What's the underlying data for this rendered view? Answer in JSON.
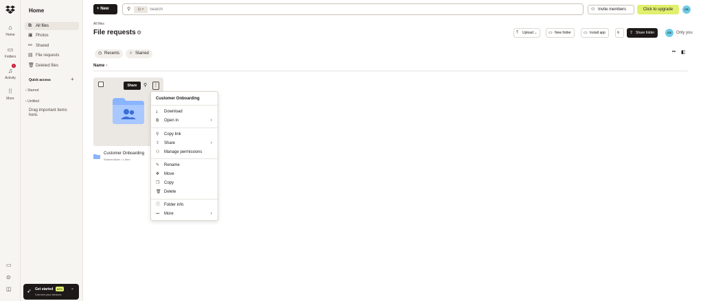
{
  "rail": {
    "items": [
      {
        "label": "Home",
        "icon": "home-icon",
        "glyph": "⌂"
      },
      {
        "label": "Folders",
        "icon": "folders-icon",
        "glyph": "▭"
      },
      {
        "label": "Activity",
        "icon": "bell-icon",
        "glyph": "♫"
      },
      {
        "label": "More",
        "icon": "grid-icon",
        "glyph": "⁞⁞"
      }
    ],
    "activity_badge": "1"
  },
  "sidebar": {
    "title": "Home",
    "items": [
      {
        "label": "All files",
        "glyph": "⧉",
        "active": true
      },
      {
        "label": "Photos",
        "glyph": "▣",
        "active": false
      },
      {
        "label": "Shared",
        "glyph": "⚯",
        "active": false
      },
      {
        "label": "File requests",
        "glyph": "▤",
        "active": false
      },
      {
        "label": "Deleted files",
        "glyph": "🗑",
        "active": false
      }
    ],
    "quick_access": "Quick access",
    "groups": [
      "Starred",
      "Untitled"
    ],
    "hint": "Drag important items here.",
    "get_started": {
      "title": "Get started",
      "percent": "66%",
      "subtitle": "Connect your devices"
    }
  },
  "topbar": {
    "new_label": "New",
    "search_placeholder": "Search",
    "search_chip": "⊡ ×",
    "invite_label": "Invite members",
    "upgrade_label": "Click to upgrade",
    "avatar_initials": "CS"
  },
  "page": {
    "breadcrumb": "All files",
    "title": "File requests",
    "actions": {
      "upload": "Upload",
      "new_folder": "New folder",
      "install_app": "Install app",
      "share_folder": "Share folder",
      "only_you": "Only you"
    },
    "filters": {
      "recents": "Recents",
      "starred": "Starred"
    },
    "column_name": "Name"
  },
  "file": {
    "name": "Customer Onboarding",
    "meta": "Shared folder • 1 item",
    "share_label": "Share"
  },
  "menu": {
    "title": "Customer Onboarding",
    "groups": [
      [
        {
          "label": "Download",
          "glyph": "⤓",
          "sub": false
        },
        {
          "label": "Open in",
          "glyph": "⧉",
          "sub": true
        }
      ],
      [
        {
          "label": "Copy link",
          "glyph": "⚲",
          "sub": false
        },
        {
          "label": "Share",
          "glyph": "⇪",
          "sub": true
        },
        {
          "label": "Manage permissions",
          "glyph": "⚇",
          "sub": false
        }
      ],
      [
        {
          "label": "Rename",
          "glyph": "✎",
          "sub": false
        },
        {
          "label": "Move",
          "glyph": "✥",
          "sub": false
        },
        {
          "label": "Copy",
          "glyph": "❐",
          "sub": false
        },
        {
          "label": "Delete",
          "glyph": "🗑",
          "sub": false
        }
      ],
      [
        {
          "label": "Folder info",
          "glyph": "ⓘ",
          "sub": false
        },
        {
          "label": "More",
          "glyph": "•••",
          "sub": true
        }
      ]
    ]
  },
  "colors": {
    "accent_lime": "#e0f06d",
    "dark": "#1e1919",
    "folder_blue": "#8ab4ff",
    "badge_red": "#c8102e"
  }
}
